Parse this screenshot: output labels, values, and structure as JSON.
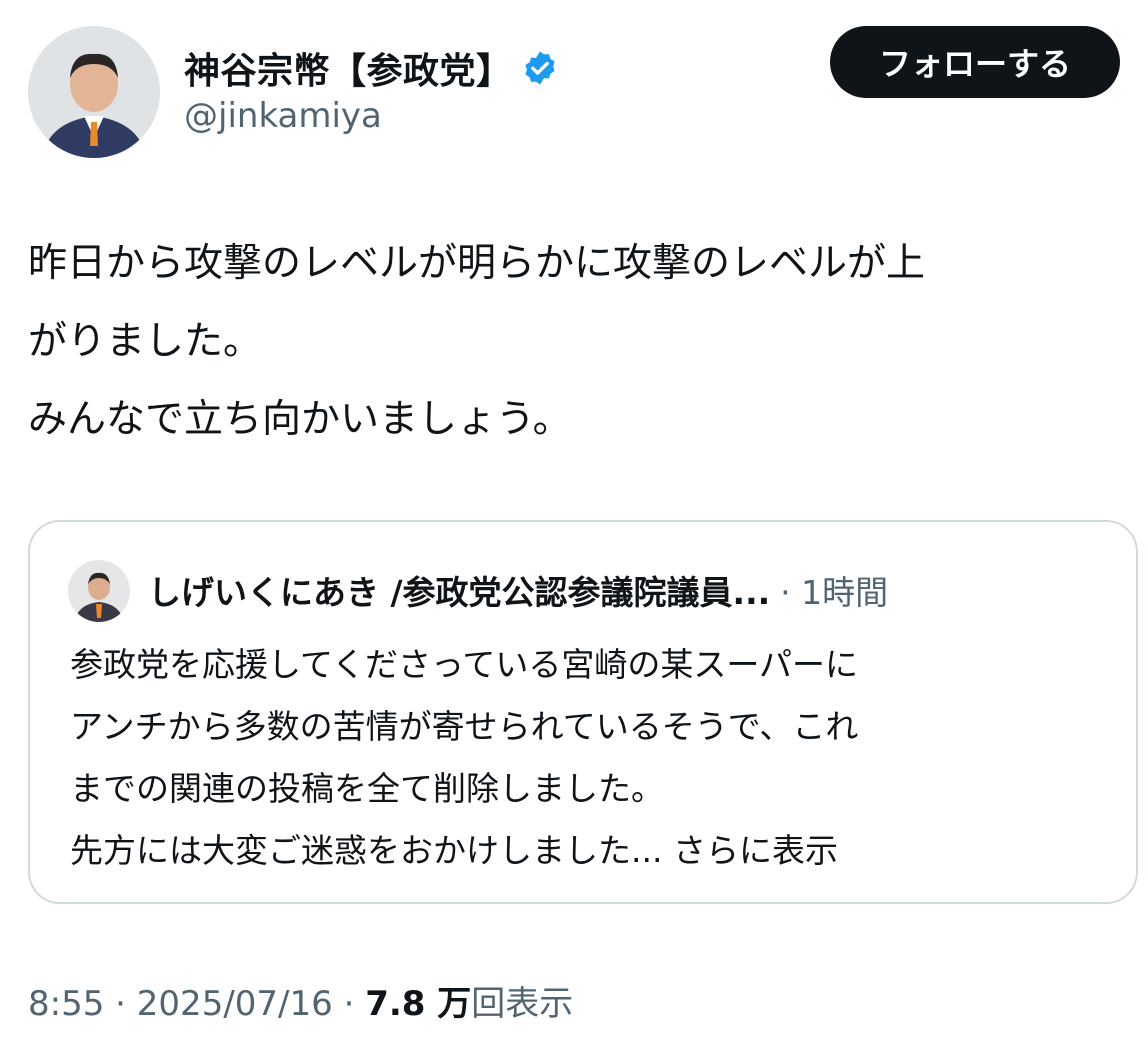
{
  "author": {
    "display_name": "神谷宗幣【参政党】",
    "handle": "@jinkamiya",
    "verified_icon": "verified-badge-icon"
  },
  "follow_button": {
    "label": "フォローする"
  },
  "tweet": {
    "text": "昨日から攻撃のレベルが明らかに攻撃のレベルが上\nがりました。\nみんなで立ち向かいましょう。"
  },
  "quote": {
    "author_name": "しげいくにあき /参政党公認参議院議員...",
    "time": "· 1時間",
    "body": "参政党を応援してくださっている宮崎の某スーパーに\nアンチから多数の苦情が寄せられているそうで、これ\nまでの関連の投稿を全て削除しました。\n先方には大変ご迷惑をおかけしました...",
    "more": " さらに表示"
  },
  "meta": {
    "time": "8:55",
    "date": "2025/07/16",
    "views_count": "7.8 万",
    "views_label": "回表示"
  },
  "colors": {
    "verified": "#1d9bf0",
    "text": "#0f1419",
    "secondary": "#536471",
    "border": "#cfd9de"
  }
}
